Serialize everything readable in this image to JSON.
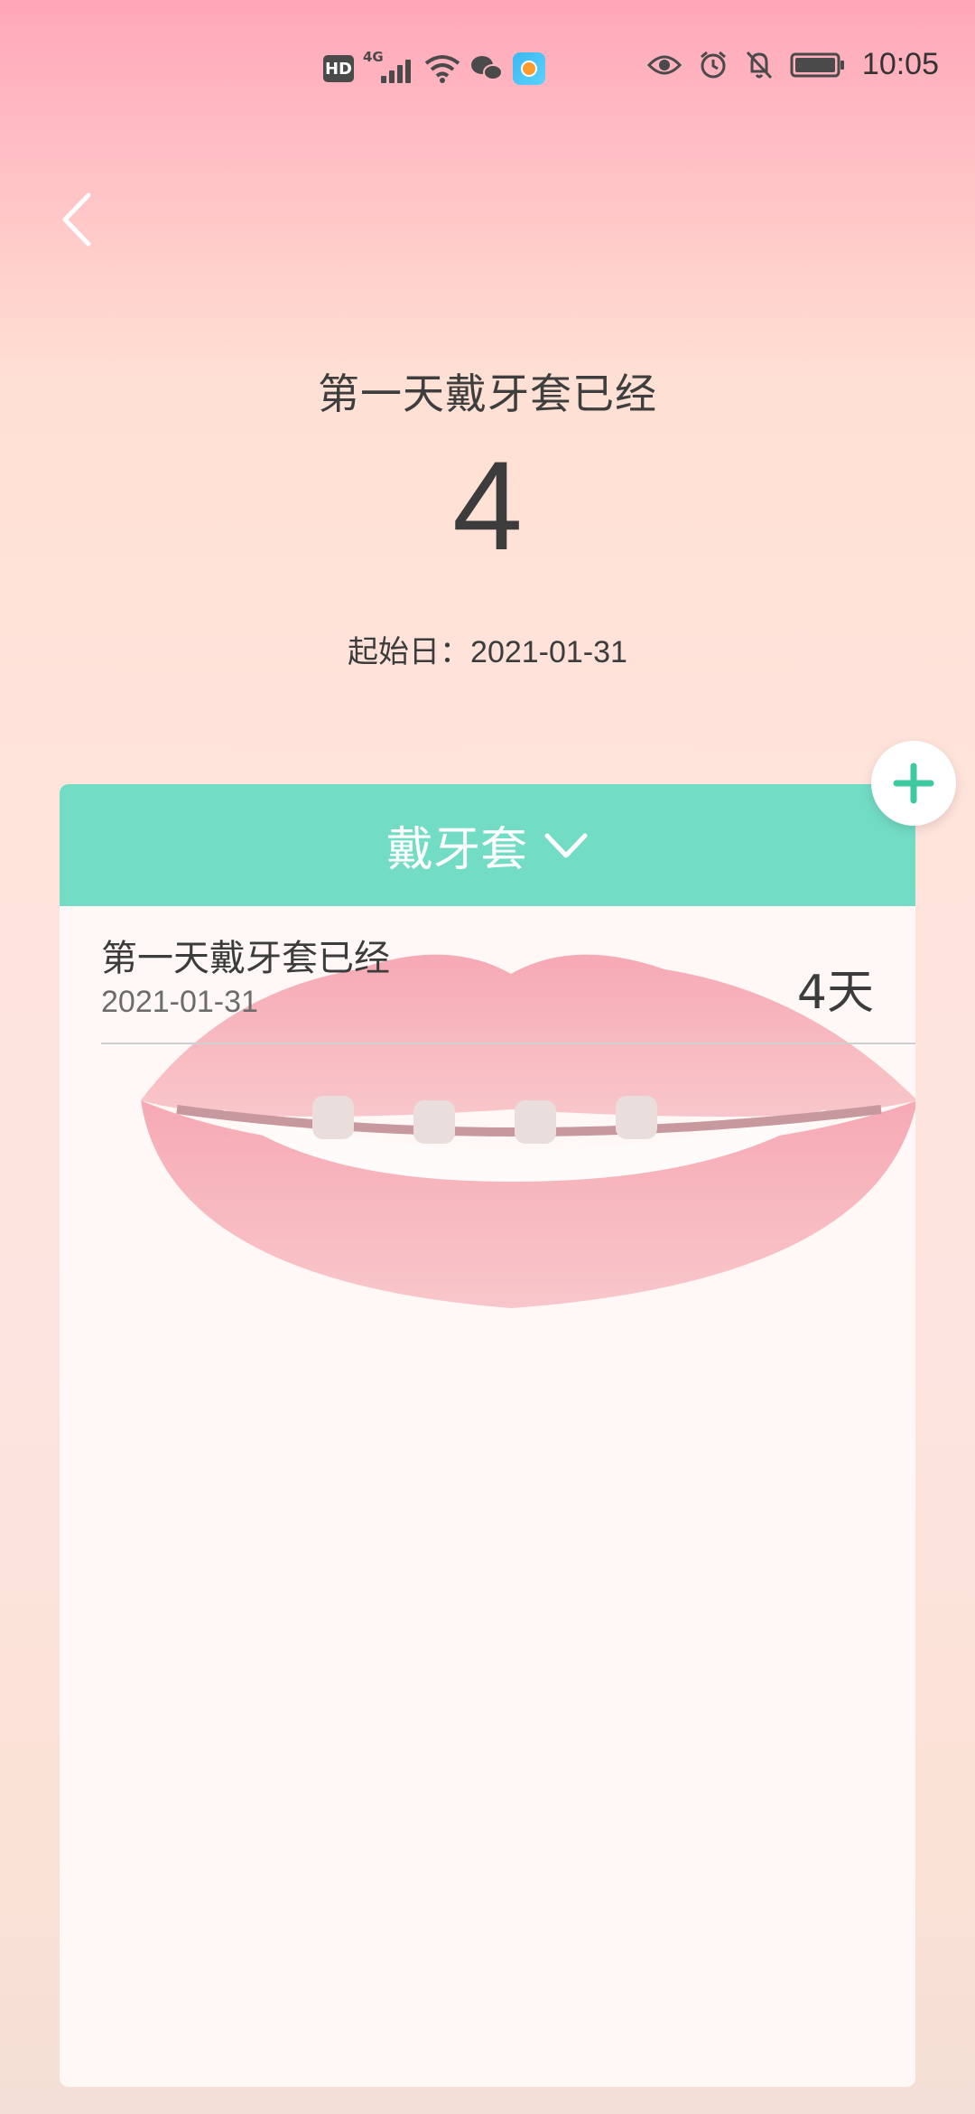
{
  "status_bar": {
    "hd": "HD",
    "network": "4G",
    "time": "10:05"
  },
  "header": {
    "title": "第一天戴牙套已经",
    "count": "4",
    "start_label": "起始日：",
    "start_date": "2021-01-31"
  },
  "card": {
    "category": "戴牙套",
    "items": [
      {
        "name": "第一天戴牙套已经",
        "date": "2021-01-31",
        "days": "4天"
      }
    ]
  },
  "colors": {
    "accent": "#73dcc5",
    "plus": "#3ec9a1",
    "bg_top": "#ffa7ba"
  }
}
